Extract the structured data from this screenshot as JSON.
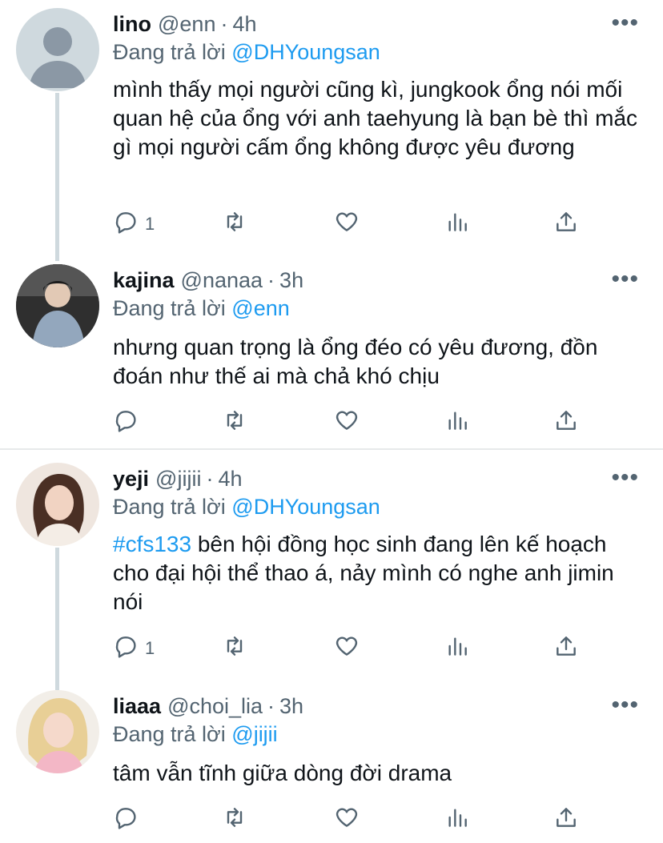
{
  "colors": {
    "accent": "#1d9bf0",
    "muted": "#536471",
    "text": "#0f1419",
    "thread_line": "#cfd9de"
  },
  "tweets": [
    {
      "name": "lino",
      "handle": "@enn",
      "time": "4h",
      "replying_prefix": "Đang trả lời",
      "replying_to": "@DHYoungsan",
      "text": "mình thấy mọi người cũng kì, jungkook ổng nói mối quan hệ của ổng với anh taehyung là bạn bè thì mắc gì mọi người cấm ổng không được yêu đương",
      "reply_count": "1",
      "more": "•••"
    },
    {
      "name": "kajina",
      "handle": "@nanaa",
      "time": "3h",
      "replying_prefix": "Đang trả lời",
      "replying_to": "@enn",
      "text": "nhưng quan trọng là ổng đéo có yêu đương, đồn đoán như thế ai mà chả khó chịu",
      "reply_count": "",
      "more": "•••"
    },
    {
      "name": "yeji",
      "handle": "@jijii",
      "time": "4h",
      "replying_prefix": "Đang trả lời",
      "replying_to": "@DHYoungsan",
      "hashtag": "#cfs133",
      "text": " bên hội đồng học sinh đang lên kế hoạch cho đại hội thể thao á, nảy mình có nghe anh jimin nói",
      "reply_count": "1",
      "more": "•••"
    },
    {
      "name": "liaaa",
      "handle": "@choi_lia",
      "time": "3h",
      "replying_prefix": "Đang trả lời",
      "replying_to": "@jijii",
      "text": "tâm vẫn tĩnh giữa dòng đời drama",
      "reply_count": "",
      "more": "•••"
    }
  ],
  "separator": "·",
  "icons": [
    "reply-icon",
    "retweet-icon",
    "like-icon",
    "analytics-icon",
    "share-icon",
    "more-icon"
  ]
}
